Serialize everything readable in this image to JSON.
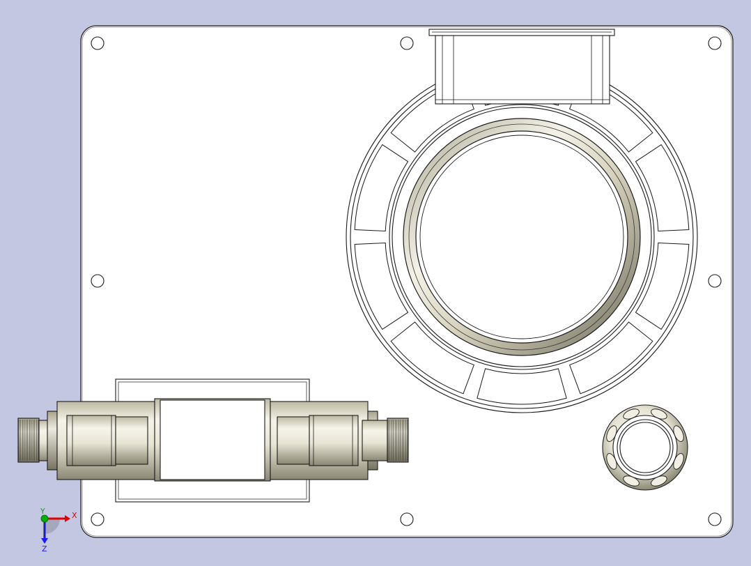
{
  "viewport": {
    "background_color": "#c4c7e2",
    "paper_color": "#ffffff",
    "line_color": "#1a1a1a",
    "metal_light": "#f3f1e6",
    "metal_mid": "#d9d6c0",
    "metal_dark": "#7d7a6a"
  },
  "model": {
    "hole_count": 8,
    "flange_rib_count": 10,
    "knob_lobe_count": 8,
    "spline_teeth_per_side": 12
  },
  "triad": {
    "x_label": "X",
    "y_label": "Y",
    "z_label": "Z",
    "x_color": "#e00000",
    "y_color": "#00b000",
    "z_color": "#1a1aff"
  }
}
